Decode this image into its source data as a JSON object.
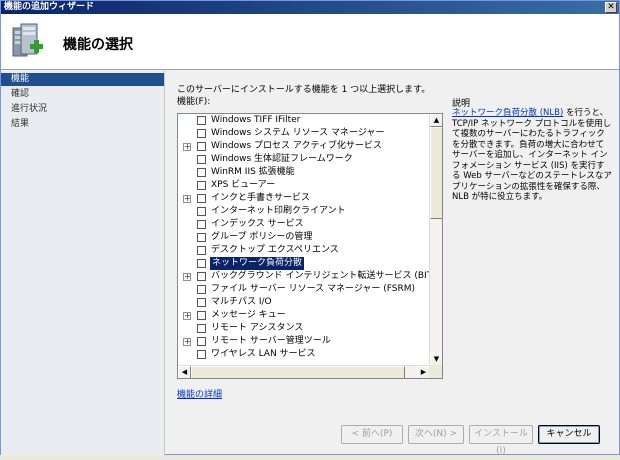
{
  "window": {
    "title": "機能の追加ウィザード",
    "close_label": "✕"
  },
  "header": {
    "title": "機能の選択",
    "icon": "add-features-wizard-icon"
  },
  "sidebar": {
    "items": [
      {
        "label": "機能",
        "active": true
      },
      {
        "label": "確認",
        "active": false
      },
      {
        "label": "進行状況",
        "active": false
      },
      {
        "label": "結果",
        "active": false
      }
    ]
  },
  "main": {
    "instruction": "このサーバーにインストールする機能を 1 つ以上選択します。",
    "features_label": "機能(F):",
    "features": [
      {
        "label": "Windows TIFF IFilter",
        "expandable": false,
        "checked": false,
        "selected": false
      },
      {
        "label": "Windows システム リソース マネージャー",
        "expandable": false,
        "checked": false,
        "selected": false
      },
      {
        "label": "Windows プロセス アクティブ化サービス",
        "expandable": true,
        "checked": false,
        "selected": false
      },
      {
        "label": "Windows 生体認証フレームワーク",
        "expandable": false,
        "checked": false,
        "selected": false
      },
      {
        "label": "WinRM IIS 拡張機能",
        "expandable": false,
        "checked": false,
        "selected": false
      },
      {
        "label": "XPS ビューアー",
        "expandable": false,
        "checked": false,
        "selected": false
      },
      {
        "label": "インクと手書きサービス",
        "expandable": true,
        "checked": false,
        "selected": false
      },
      {
        "label": "インターネット印刷クライアント",
        "expandable": false,
        "checked": false,
        "selected": false
      },
      {
        "label": "インデックス サービス",
        "expandable": false,
        "checked": false,
        "selected": false
      },
      {
        "label": "グループ ポリシーの管理",
        "expandable": false,
        "checked": false,
        "selected": false
      },
      {
        "label": "デスクトップ エクスペリエンス",
        "expandable": false,
        "checked": false,
        "selected": false
      },
      {
        "label": "ネットワーク負荷分散",
        "expandable": false,
        "checked": false,
        "selected": true
      },
      {
        "label": "バックグラウンド インテリジェント転送サービス (BITS)",
        "expandable": true,
        "checked": false,
        "selected": false
      },
      {
        "label": "ファイル サーバー リソース マネージャー (FSRM)",
        "expandable": false,
        "checked": false,
        "selected": false
      },
      {
        "label": "マルチパス I/O",
        "expandable": false,
        "checked": false,
        "selected": false
      },
      {
        "label": "メッセージ キュー",
        "expandable": true,
        "checked": false,
        "selected": false
      },
      {
        "label": "リモート アシスタンス",
        "expandable": false,
        "checked": false,
        "selected": false
      },
      {
        "label": "リモート サーバー管理ツール",
        "expandable": true,
        "checked": false,
        "selected": false
      },
      {
        "label": "ワイヤレス LAN サービス",
        "expandable": false,
        "checked": false,
        "selected": false
      }
    ],
    "details_link": "機能の詳細"
  },
  "description": {
    "title": "説明",
    "link_text": "ネットワーク負荷分散 (NLB)",
    "text": " を行うと、TCP/IP ネットワーク プロトコルを使用して複数のサーバーにわたるトラフィックを分散できます。負荷の増大に合わせてサーバーを追加し、インターネット インフォメーション サービス (IIS) を実行する Web サーバーなどのステートレスなアプリケーションの拡張性を確保する際、NLB が特に役立ちます。"
  },
  "footer": {
    "back_label": "< 前へ(P)",
    "next_label": "次へ(N) >",
    "install_label": "インストール(I)",
    "cancel_label": "キャンセル"
  }
}
